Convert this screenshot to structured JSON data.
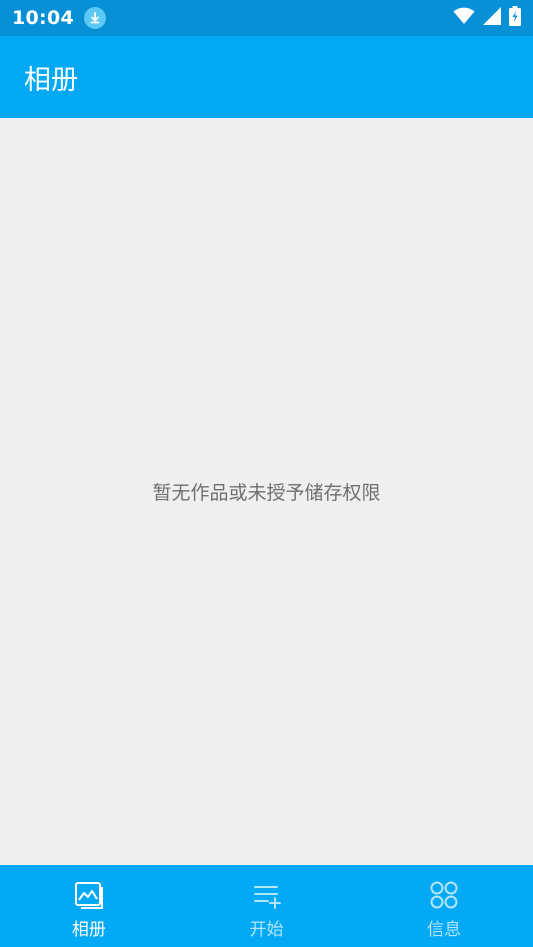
{
  "status_bar": {
    "time": "10:04",
    "icons": [
      "download-icon",
      "wifi-icon",
      "signal-icon",
      "battery-charging-icon"
    ]
  },
  "app_bar": {
    "title": "相册"
  },
  "main": {
    "empty_message": "暂无作品或未授予储存权限"
  },
  "bottom_nav": {
    "items": [
      {
        "label": "相册",
        "icon": "album-icon",
        "active": true
      },
      {
        "label": "开始",
        "icon": "list-add-icon",
        "active": false
      },
      {
        "label": "信息",
        "icon": "grid-dots-icon",
        "active": false
      }
    ]
  },
  "colors": {
    "status_bar": "#0890d6",
    "primary": "#03a9f4",
    "background": "#efefef",
    "empty_text": "#6f6f6f"
  }
}
